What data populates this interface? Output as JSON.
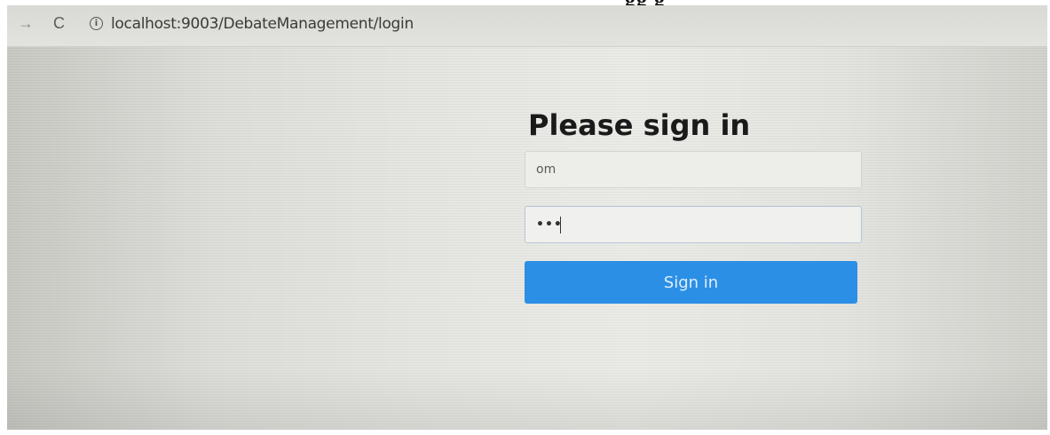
{
  "caption": {
    "fragment": "gg g"
  },
  "browser": {
    "url": "localhost:9003/DebateManagement/login",
    "forward_icon": "→",
    "reload_icon": "C",
    "info_icon": "i"
  },
  "login": {
    "title": "Please sign in",
    "username_value": "om",
    "password_mask": "•••",
    "submit_label": "Sign in"
  },
  "colors": {
    "button": "#2b8fe6",
    "heading": "#1a1a1a"
  }
}
